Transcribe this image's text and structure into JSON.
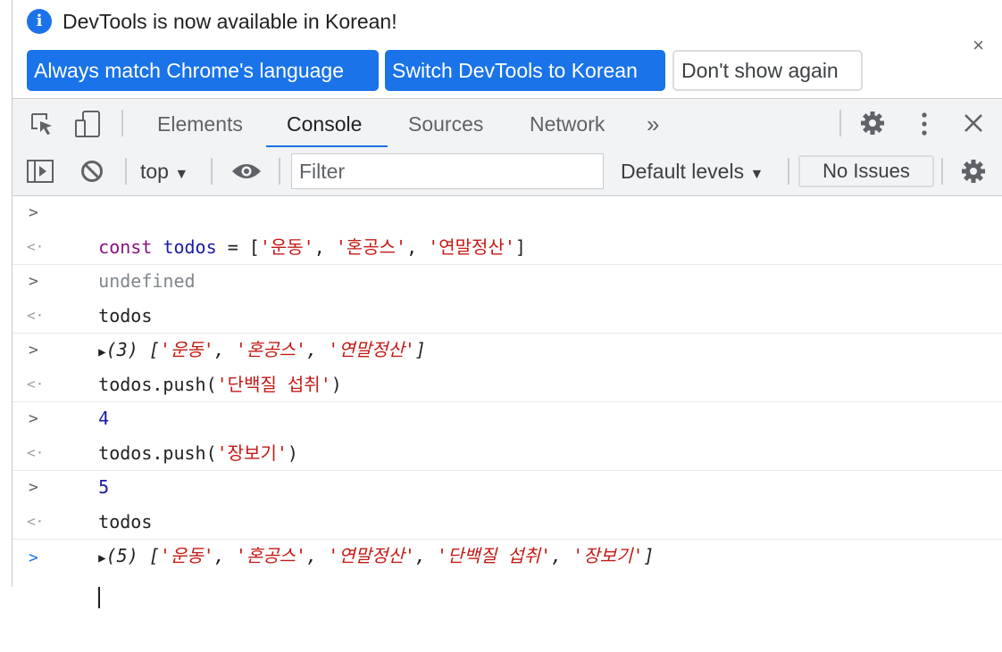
{
  "infobar": {
    "message": "DevTools is now available in Korean!",
    "btn_match": "Always match Chrome's language",
    "btn_switch": "Switch DevTools to Korean",
    "btn_dont_show": "Don't show again",
    "close": "×"
  },
  "tabs": {
    "elements": "Elements",
    "console": "Console",
    "sources": "Sources",
    "network": "Network",
    "more": "»"
  },
  "console_toolbar": {
    "context": "top",
    "filter_placeholder": "Filter",
    "levels": "Default levels",
    "issues": "No Issues"
  },
  "console": {
    "l1": {
      "kw": "const",
      "name": "todos",
      "eq": " = [",
      "s1": "'운동'",
      "s2": "'혼공스'",
      "s3": "'연말정산'",
      "close": "]"
    },
    "r1": "undefined",
    "l2": "todos",
    "r2": {
      "count": "(3)",
      "open": "[",
      "s1": "'운동'",
      "s2": "'혼공스'",
      "s3": "'연말정산'",
      "close": "]"
    },
    "l3": {
      "pre": "todos.push(",
      "arg": "'단백질 섭취'",
      "post": ")"
    },
    "r3": "4",
    "l4": {
      "pre": "todos.push(",
      "arg": "'장보기'",
      "post": ")"
    },
    "r4": "5",
    "l5": "todos",
    "r5": {
      "count": "(5)",
      "open": "[",
      "s1": "'운동'",
      "s2": "'혼공스'",
      "s3": "'연말정산'",
      "s4": "'단백질 섭취'",
      "s5": "'장보기'",
      "close": "]"
    }
  },
  "colors": {
    "accent": "#1a73e8",
    "keyword": "#881280",
    "string": "#c41a16",
    "number": "#1a1aa6"
  },
  "icons": [
    "info-icon",
    "close-icon",
    "inspect-icon",
    "device-toggle-icon",
    "gear-icon",
    "kebab-menu-icon",
    "sidebar-toggle-icon",
    "clear-console-icon",
    "eye-icon",
    "chevron-right-icon"
  ]
}
